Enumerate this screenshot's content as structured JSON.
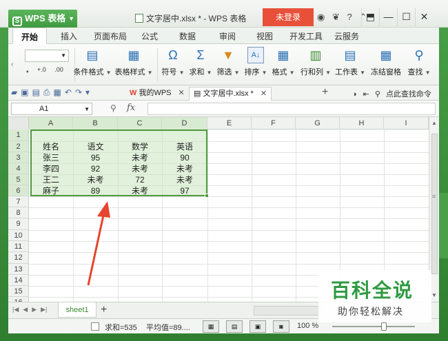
{
  "window": {
    "app_name": "WPS 表格",
    "doc_title": "文字居中.xlsx * - WPS 表格",
    "login_label": "未登录",
    "title_icons": [
      "◉",
      "❦",
      "?",
      "⌃"
    ],
    "win_controls": [
      "⬒",
      "—",
      "☐",
      "✕"
    ]
  },
  "tabs": [
    "开始",
    "插入",
    "页面布局",
    "公式",
    "数据",
    "审阅",
    "视图",
    "开发工具",
    "云服务"
  ],
  "ribbon": {
    "small_labels": [
      "+.0",
      ".00"
    ],
    "buttons": [
      {
        "label": "条件格式",
        "icon": "▤"
      },
      {
        "label": "表格样式",
        "icon": "▦"
      },
      {
        "label": "符号",
        "icon": "Ω"
      },
      {
        "label": "求和",
        "icon": "Σ"
      },
      {
        "label": "筛选",
        "icon": "▼"
      },
      {
        "label": "排序",
        "icon": "A↓"
      },
      {
        "label": "格式",
        "icon": "▦"
      },
      {
        "label": "行和列",
        "icon": "▥"
      },
      {
        "label": "工作表",
        "icon": "▤"
      },
      {
        "label": "冻结窗格",
        "icon": "▦"
      },
      {
        "label": "查找",
        "icon": "⚲"
      }
    ]
  },
  "doc_tabs": [
    {
      "label": "我的WPS",
      "active": false
    },
    {
      "label": "文字居中.xlsx *",
      "active": true
    }
  ],
  "right_tools": {
    "search_label": "点此查找命令"
  },
  "formula_bar": {
    "cell_ref": "A1",
    "fx": "fx",
    "value": ""
  },
  "columns": [
    "A",
    "B",
    "C",
    "D",
    "E",
    "F",
    "G",
    "H",
    "I"
  ],
  "rows": [
    "1",
    "2",
    "3",
    "4",
    "5",
    "6",
    "7",
    "8",
    "9",
    "10",
    "11",
    "12",
    "13",
    "14",
    "15",
    "16"
  ],
  "table": {
    "header": [
      "姓名",
      "语文",
      "数学",
      "英语"
    ],
    "body": [
      [
        "张三",
        "95",
        "未考",
        "90"
      ],
      [
        "李四",
        "92",
        "未考",
        "未考"
      ],
      [
        "王二",
        "未考",
        "72",
        "未考"
      ],
      [
        "麻子",
        "89",
        "未考",
        "97"
      ]
    ]
  },
  "sheet": {
    "name": "sheet1"
  },
  "status": {
    "sum": "求和=535",
    "avg": "平均值=89....",
    "zoom": "100 %"
  },
  "watermark": {
    "main": "百科全说",
    "sub": "助你轻松解决"
  },
  "colors": {
    "accent": "#3f9a3f",
    "selection_border": "#4e9a3e",
    "login": "#e8503a",
    "annotation_arrow": "#e6442e"
  }
}
